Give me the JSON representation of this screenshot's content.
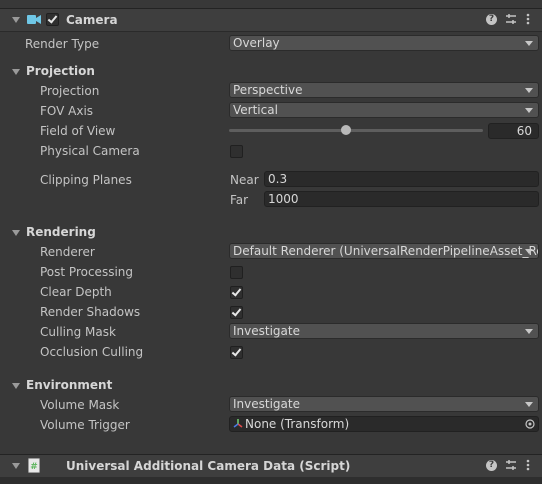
{
  "camera_header": {
    "title": "Camera",
    "enabled": true
  },
  "render_type": {
    "label": "Render Type",
    "value": "Overlay"
  },
  "projection_section": {
    "title": "Projection",
    "projection": {
      "label": "Projection",
      "value": "Perspective"
    },
    "fov_axis": {
      "label": "FOV Axis",
      "value": "Vertical"
    },
    "field_of_view": {
      "label": "Field of View",
      "value": "60",
      "slider_fraction": 0.46
    },
    "physical_camera": {
      "label": "Physical Camera",
      "checked": false
    },
    "clipping_planes": {
      "label": "Clipping Planes",
      "near_label": "Near",
      "near": "0.3",
      "far_label": "Far",
      "far": "1000"
    }
  },
  "rendering_section": {
    "title": "Rendering",
    "renderer": {
      "label": "Renderer",
      "value": "Default Renderer (UniversalRenderPipelineAsset_Re"
    },
    "post_processing": {
      "label": "Post Processing",
      "checked": false
    },
    "clear_depth": {
      "label": "Clear Depth",
      "checked": true
    },
    "render_shadows": {
      "label": "Render Shadows",
      "checked": true
    },
    "culling_mask": {
      "label": "Culling Mask",
      "value": "Investigate"
    },
    "occlusion_culling": {
      "label": "Occlusion Culling",
      "checked": true
    }
  },
  "environment_section": {
    "title": "Environment",
    "volume_mask": {
      "label": "Volume Mask",
      "value": "Investigate"
    },
    "volume_trigger": {
      "label": "Volume Trigger",
      "value": "None (Transform)"
    }
  },
  "script_header": {
    "title": "Universal Additional Camera Data (Script)"
  },
  "colors": {
    "background": "#383838",
    "camera_icon": "#6fc7e6",
    "script_icon_green": "#5bb55b"
  }
}
